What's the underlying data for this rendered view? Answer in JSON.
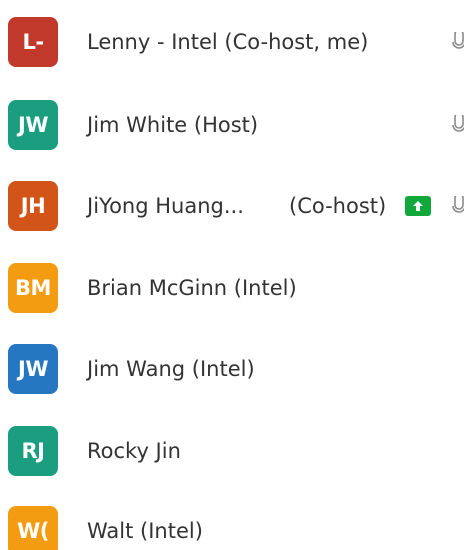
{
  "participants": [
    {
      "initials": "L-",
      "name": "Lenny - Intel (Co-host, me)",
      "color": "#c0392b",
      "has_mic_icon": true
    },
    {
      "initials": "JW",
      "name": "Jim White (Host)",
      "color": "#1a9e7f",
      "has_mic_icon": true
    },
    {
      "initials": "JH",
      "name": "JiYong Huang...",
      "role": "(Co-host)",
      "color": "#d35418",
      "has_share_badge": true,
      "share_icon": "arrow-up-icon",
      "has_mic_icon": true
    },
    {
      "initials": "BM",
      "name": "Brian McGinn (Intel)",
      "color": "#f39c12"
    },
    {
      "initials": "JW",
      "name": "Jim Wang (Intel)",
      "color": "#2577c2"
    },
    {
      "initials": "RJ",
      "name": "Rocky Jin",
      "color": "#1a9e7f"
    },
    {
      "initials": "W(",
      "name": "Walt (Intel)",
      "color": "#f39c12"
    }
  ],
  "colors": {
    "text": "#333333",
    "share_badge": "#11a83b",
    "background": "#ffffff"
  }
}
